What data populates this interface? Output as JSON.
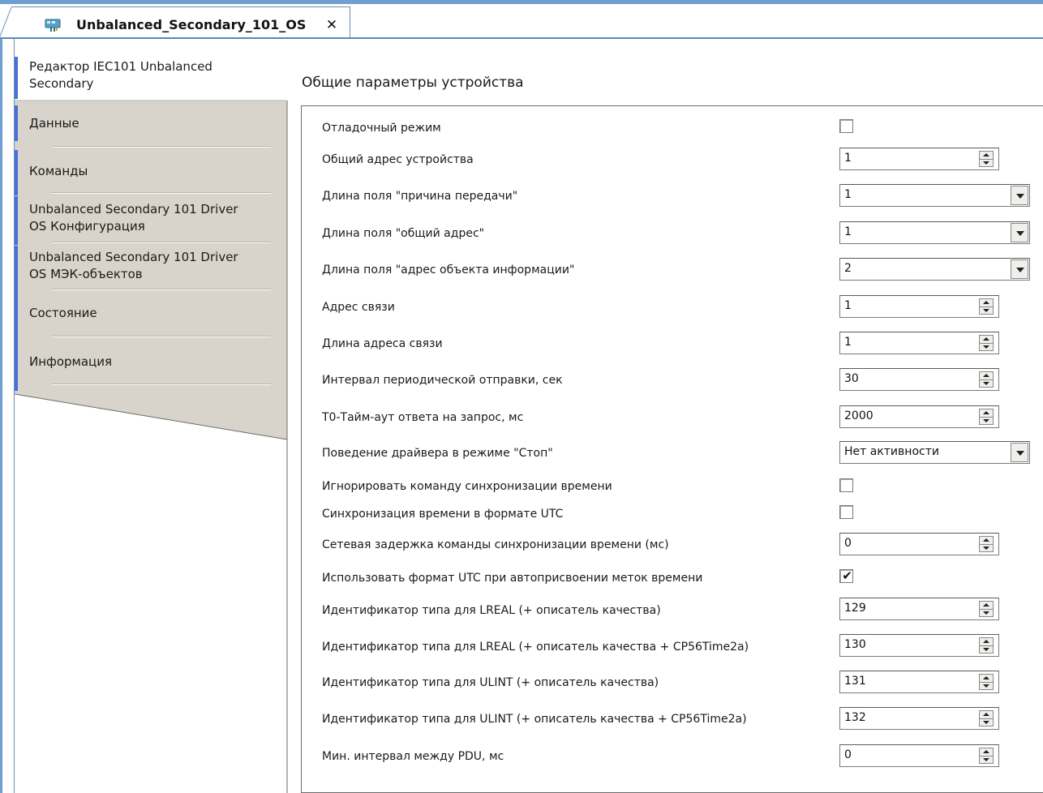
{
  "tab": {
    "title": "Unbalanced_Secondary_101_OS",
    "close_label": "✕",
    "icon": "device-icon"
  },
  "sidebar": {
    "items": [
      {
        "label": "Редактор IEC101 Unbalanced\nSecondary",
        "line1": "Редактор IEC101 Unbalanced",
        "line2": "Secondary",
        "active": true
      },
      {
        "label": "Данные"
      },
      {
        "label": "Команды"
      },
      {
        "line1": "Unbalanced Secondary 101 Driver",
        "line2": "OS Конфигурация"
      },
      {
        "line1": "Unbalanced Secondary 101 Driver",
        "line2": "OS МЭК-объектов"
      },
      {
        "label": "Состояние"
      },
      {
        "label": "Информация"
      }
    ]
  },
  "main": {
    "section_title": "Общие параметры устройства",
    "params": [
      {
        "label": "Отладочный режим",
        "kind": "checkbox",
        "checked": false
      },
      {
        "label": "Общий адрес устройства",
        "kind": "spin",
        "value": "1"
      },
      {
        "label": "Длина поля \"причина передачи\"",
        "kind": "dropdown",
        "value": "1"
      },
      {
        "label": "Длина поля \"общий адрес\"",
        "kind": "dropdown",
        "value": "1"
      },
      {
        "label": "Длина поля \"адрес объекта информации\"",
        "kind": "dropdown",
        "value": "2"
      },
      {
        "label": "Адрес связи",
        "kind": "spin",
        "value": "1"
      },
      {
        "label": "Длина адреса связи",
        "kind": "spin",
        "value": "1"
      },
      {
        "label": "Интервал периодической отправки, сек",
        "kind": "spin",
        "value": "30"
      },
      {
        "label": "T0-Тайм-аут ответа на запрос, мс",
        "kind": "spin",
        "value": "2000"
      },
      {
        "label": "Поведение драйвера в режиме \"Стоп\"",
        "kind": "dropdown",
        "value": "Нет активности"
      },
      {
        "label": "Игнорировать команду синхронизации времени",
        "kind": "checkbox",
        "checked": false
      },
      {
        "label": "Синхронизация времени в формате UTC",
        "kind": "checkbox",
        "checked": false
      },
      {
        "label": "Сетевая задержка команды синхронизации времени (мс)",
        "kind": "spin",
        "value": "0"
      },
      {
        "label": "Использовать формат UTC при автоприсвоении меток времени",
        "kind": "checkbox",
        "checked": true,
        "mark": "✔"
      },
      {
        "label": "Идентификатор типа для LREAL (+ описатель качества)",
        "kind": "spin",
        "value": "129"
      },
      {
        "label": "Идентификатор типа для LREAL (+ описатель качества + CP56Time2a)",
        "kind": "spin",
        "value": "130"
      },
      {
        "label": "Идентификатор типа для ULINT (+ описатель качества)",
        "kind": "spin",
        "value": "131"
      },
      {
        "label": "Идентификатор типа для ULINT (+ описатель качества + CP56Time2a)",
        "kind": "spin",
        "value": "132"
      },
      {
        "label": "Мин. интервал между PDU, мс",
        "kind": "spin",
        "value": "0"
      }
    ]
  },
  "colors": {
    "accent_blue": "#4a6fd8",
    "sidebar_gray": "#d8d4cc",
    "frame_blue": "#6f9fd0"
  }
}
